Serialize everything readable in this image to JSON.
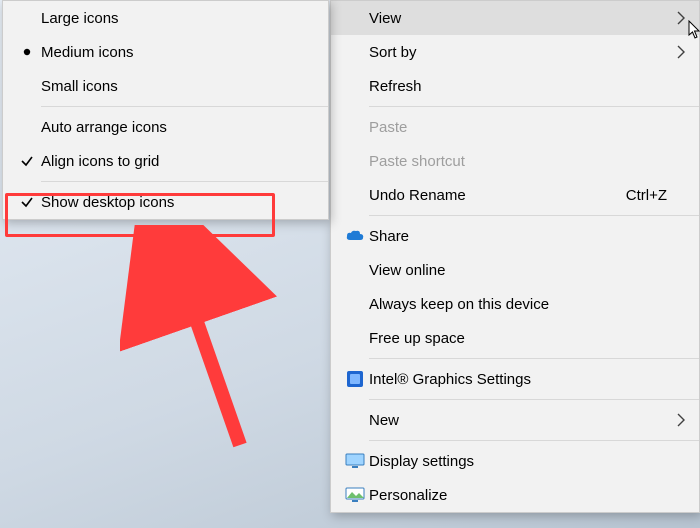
{
  "primary_menu": {
    "items": {
      "view": {
        "label": "View"
      },
      "sort_by": {
        "label": "Sort by"
      },
      "refresh": {
        "label": "Refresh"
      },
      "paste": {
        "label": "Paste"
      },
      "paste_shortcut": {
        "label": "Paste shortcut"
      },
      "undo_rename": {
        "label": "Undo Rename",
        "accel": "Ctrl+Z"
      },
      "share": {
        "label": "Share"
      },
      "view_online": {
        "label": "View online"
      },
      "always_keep": {
        "label": "Always keep on this device"
      },
      "free_up": {
        "label": "Free up space"
      },
      "graphics": {
        "label": "Intel® Graphics Settings"
      },
      "new": {
        "label": "New"
      },
      "display": {
        "label": "Display settings"
      },
      "personalize": {
        "label": "Personalize"
      }
    }
  },
  "sub_menu": {
    "items": {
      "large": {
        "label": "Large icons"
      },
      "medium": {
        "label": "Medium icons"
      },
      "small": {
        "label": "Small icons"
      },
      "auto": {
        "label": "Auto arrange icons"
      },
      "align": {
        "label": "Align icons to grid"
      },
      "show": {
        "label": "Show desktop icons"
      }
    }
  }
}
